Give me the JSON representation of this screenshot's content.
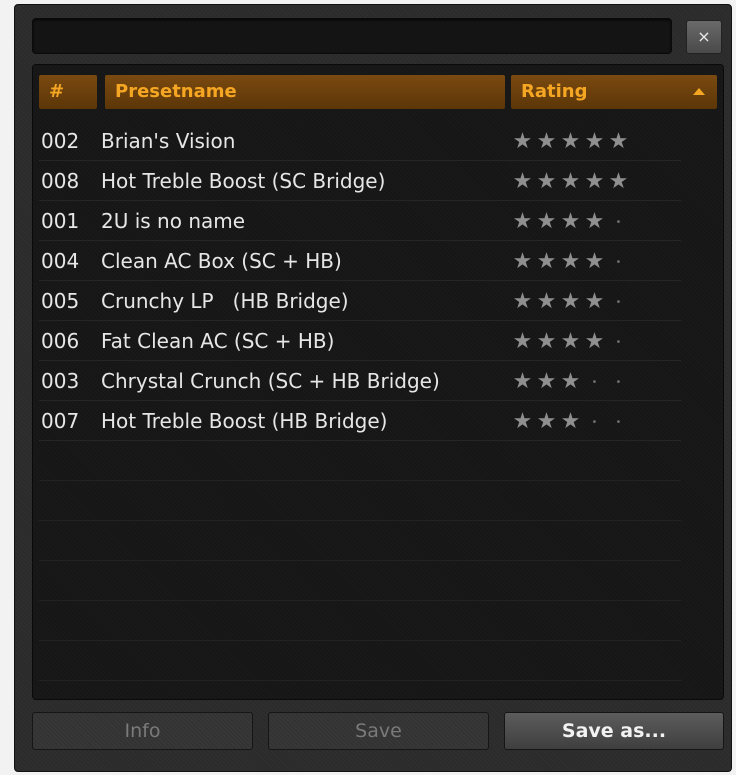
{
  "search": {
    "value": "",
    "placeholder": ""
  },
  "close_label": "×",
  "columns": {
    "number": "#",
    "name": "Presetname",
    "rating": "Rating"
  },
  "sort": {
    "column": "rating",
    "direction": "descending"
  },
  "rating_max": 5,
  "presets": [
    {
      "number": "002",
      "name": "Brian's Vision",
      "rating": 5
    },
    {
      "number": "008",
      "name": "Hot Treble Boost (SC Bridge)",
      "rating": 5
    },
    {
      "number": "001",
      "name": "2U is no name",
      "rating": 4
    },
    {
      "number": "004",
      "name": "Clean AC Box (SC + HB)",
      "rating": 4
    },
    {
      "number": "005",
      "name": "Crunchy LP   (HB Bridge)",
      "rating": 4
    },
    {
      "number": "006",
      "name": "Fat Clean AC (SC + HB)",
      "rating": 4
    },
    {
      "number": "003",
      "name": "Chrystal Crunch (SC + HB Bridge)",
      "rating": 3
    },
    {
      "number": "007",
      "name": "Hot Treble Boost (HB Bridge)",
      "rating": 3
    }
  ],
  "buttons": {
    "info": "Info",
    "save": "Save",
    "save_as": "Save as..."
  },
  "colors": {
    "accent": "#f5a623",
    "header_bg": "#6b3f0c",
    "panel_bg": "#2b2b2b",
    "list_bg": "#161616"
  }
}
